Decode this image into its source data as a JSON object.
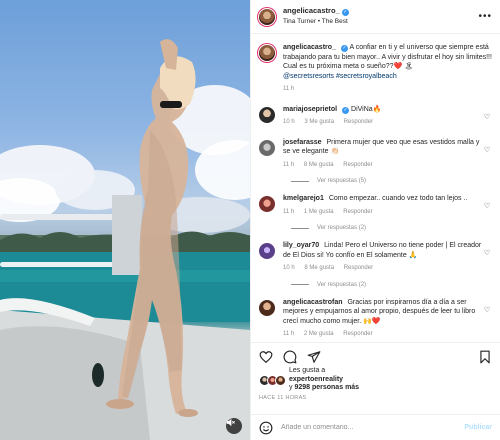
{
  "post": {
    "username": "angelicacastro_",
    "audio": "Tina Turner • The Best",
    "caption": "A confiar en ti y el universo que siempre está trabajando para tu bien mayor.. A vivir y disfrutar el hoy sin limites!!! Cual es tu próxima meta o sueño??❤️ 🏝",
    "caption_tags": "@secretsresorts #secretsroyalbeach",
    "caption_time": "11 h"
  },
  "comments": [
    {
      "user": "mariajoseprietol",
      "verified": true,
      "text": "DiViNa🔥",
      "time": "10 h",
      "likes": "3 Me gusta",
      "reply": "Responder",
      "replies": ""
    },
    {
      "user": "josefarasse",
      "verified": false,
      "text": "Primera mujer que veo que esas vestidos malla y se ve elegante 👏🏻",
      "time": "11 h",
      "likes": "8 Me gusta",
      "reply": "Responder",
      "replies": "Ver respuestas (5)"
    },
    {
      "user": "kmelgarejo1",
      "verified": false,
      "text": "Como empezar.. cuando vez todo tan lejos ..",
      "time": "11 h",
      "likes": "1 Me gusta",
      "reply": "Responder",
      "replies": "Ver respuestas (2)"
    },
    {
      "user": "lily_oyar70",
      "verified": false,
      "text": "Linda! Pero el Universo no tiene poder | El creador de El Dios si! Yo confío en El solamente 🙏",
      "time": "10 h",
      "likes": "8 Me gusta",
      "reply": "Responder",
      "replies": "Ver respuestas (2)"
    },
    {
      "user": "angelicacastrofan",
      "verified": false,
      "text": "Gracias por inspirarnos día a día a ser mejores y empujarnos al amor propio, después de leer tu libro crecí mucho como mujer. 🙌❤️",
      "time": "11 h",
      "likes": "2 Me gusta",
      "reply": "Responder",
      "replies": ""
    }
  ],
  "likes": {
    "line1": "Les gusta a",
    "liker": "expertoenreality",
    "line2_prefix": "y",
    "count": "9298 personas",
    "line2_suffix": "más"
  },
  "time_ago": "HACE 11 HORAS",
  "composer": {
    "placeholder": "Añade un comentario...",
    "publish": "Publicar"
  },
  "icons": {
    "more": "more-options-icon",
    "heart": "heart-icon",
    "comment": "comment-icon",
    "share": "share-icon",
    "save": "bookmark-icon",
    "emoji": "emoji-icon",
    "mute": "mute-icon"
  },
  "colors": {
    "link": "#00376b",
    "verified": "#3897f0",
    "muted": "#8e8e8e",
    "publish_disabled": "#b2dffc"
  }
}
